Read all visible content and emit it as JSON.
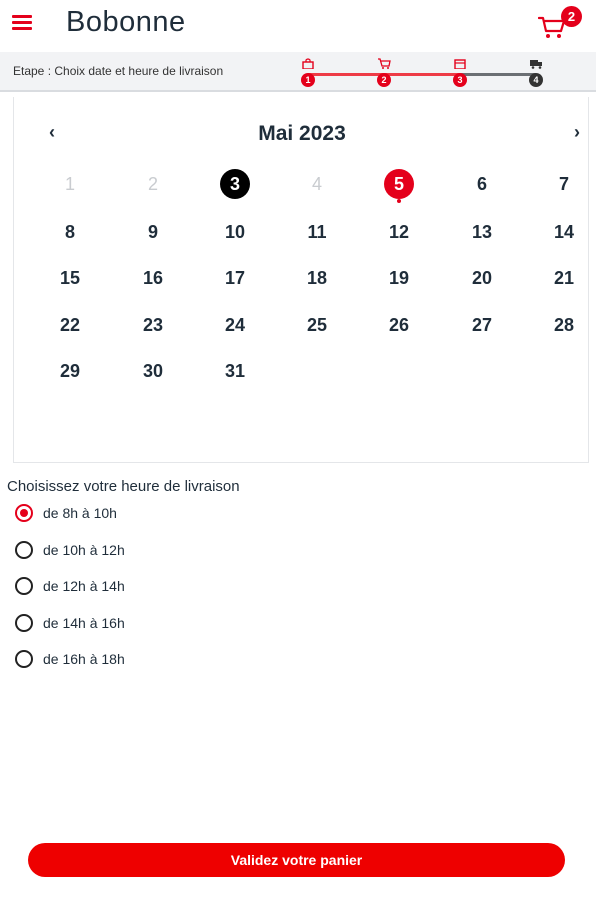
{
  "header": {
    "title": "Bobonne",
    "cart_count": "2"
  },
  "steps": {
    "label": "Etape : Choix date et heure de livraison",
    "progress": 0.67,
    "items": [
      {
        "number": "1",
        "icon": "bag-icon",
        "state": "done"
      },
      {
        "number": "2",
        "icon": "cart-icon",
        "state": "done"
      },
      {
        "number": "3",
        "icon": "calendar-icon",
        "state": "current"
      },
      {
        "number": "4",
        "icon": "truck-icon",
        "state": "todo"
      }
    ]
  },
  "calendar": {
    "prev_label": "‹",
    "next_label": "›",
    "month": "Mai 2023",
    "days": [
      "1",
      "2",
      "3",
      "4",
      "5",
      "6",
      "7",
      "8",
      "9",
      "10",
      "11",
      "12",
      "13",
      "14",
      "15",
      "16",
      "17",
      "18",
      "19",
      "20",
      "21",
      "22",
      "23",
      "24",
      "25",
      "26",
      "27",
      "28",
      "29",
      "30",
      "31"
    ],
    "disabled_days": [
      "1",
      "2",
      "4"
    ],
    "today": "3",
    "selected": "5"
  },
  "time": {
    "title": "Choisissez votre heure de livraison",
    "slots": [
      "de 8h à 10h",
      "de 10h à 12h",
      "de 12h à 14h",
      "de 14h à 16h",
      "de 16h à 18h"
    ],
    "selected_index": 0
  },
  "submit_label": "Validez votre panier",
  "colors": {
    "accent": "#e4001b",
    "text": "#1f2d3a",
    "today": "#000000",
    "disabled": "#c9ccd0"
  }
}
